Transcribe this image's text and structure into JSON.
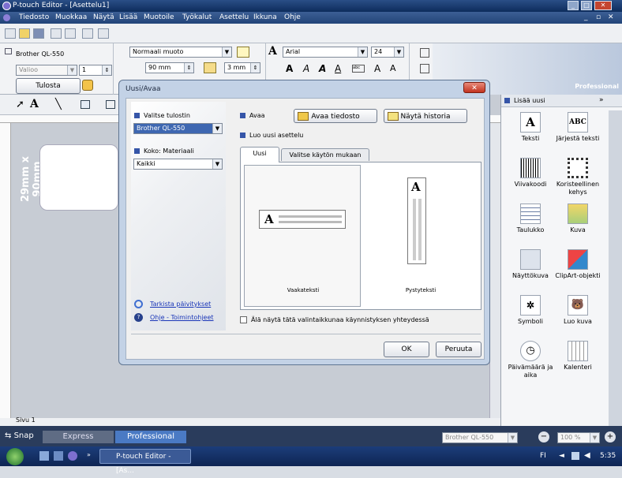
{
  "window": {
    "title": "P-touch Editor - [Asettelu1]"
  },
  "menu": [
    "Tiedosto",
    "Muokkaa",
    "Näytä",
    "Lisää",
    "Muotoile",
    "Työkalut",
    "Asettelu",
    "Ikkuna",
    "Ohje"
  ],
  "printer": {
    "name": "Brother QL-550",
    "media": "Valioo",
    "copies": "1",
    "print_label": "Tulosta"
  },
  "format": {
    "style": "Normaali muoto",
    "width": "90 mm",
    "margin": "3 mm",
    "font": "Arial",
    "size": "24",
    "brand": "Professional"
  },
  "canvas": {
    "label_size": "29mm x 90mm",
    "page_label": "Sivu 1"
  },
  "rightpanel": {
    "header": "Lisää uusi",
    "items": [
      {
        "label": "Teksti",
        "icon": "text-icon"
      },
      {
        "label": "Järjestä teksti",
        "icon": "arrange-text-icon"
      },
      {
        "label": "Viivakoodi",
        "icon": "barcode-icon"
      },
      {
        "label": "Koristeellinen kehys",
        "icon": "frame-icon"
      },
      {
        "label": "Taulukko",
        "icon": "table-icon"
      },
      {
        "label": "Kuva",
        "icon": "image-icon"
      },
      {
        "label": "Näyttökuva",
        "icon": "screenshot-icon"
      },
      {
        "label": "ClipArt-objekti",
        "icon": "clipart-icon"
      },
      {
        "label": "Symboli",
        "icon": "symbol-icon"
      },
      {
        "label": "Luo kuva",
        "icon": "create-image-icon"
      },
      {
        "label": "Päivämäärä ja aika",
        "icon": "datetime-icon"
      },
      {
        "label": "Kalenteri",
        "icon": "calendar-icon"
      }
    ]
  },
  "dialog": {
    "title": "Uusi/Avaa",
    "select_printer_label": "Valitse tulostin",
    "printer_value": "Brother QL-550",
    "size_label": "Koko: Materiaali",
    "size_value": "Kaikki",
    "open_label": "Avaa",
    "open_file_button": "Avaa tiedosto",
    "history_button": "Näytä historia",
    "new_layout_label": "Luo uusi asettelu",
    "tabs": [
      "Uusi",
      "Valitse käytön mukaan"
    ],
    "horizontal_label": "Vaakateksti",
    "vertical_label": "Pystyteksti",
    "checkbox_label": "Älä näytä tätä valintaikkunaa käynnistyksen yhteydessä",
    "updates_link": "Tarkista päivitykset",
    "help_link": "Ohje - Toimintohjeet",
    "ok": "OK",
    "cancel": "Peruuta"
  },
  "status": {
    "snap": "Snap",
    "express": "Express",
    "professional": "Professional",
    "printer": "Brother QL-550",
    "zoom": "100 %"
  },
  "taskbar": {
    "task": "P-touch Editor - [As...",
    "lang": "FI",
    "clock": "5:35"
  }
}
